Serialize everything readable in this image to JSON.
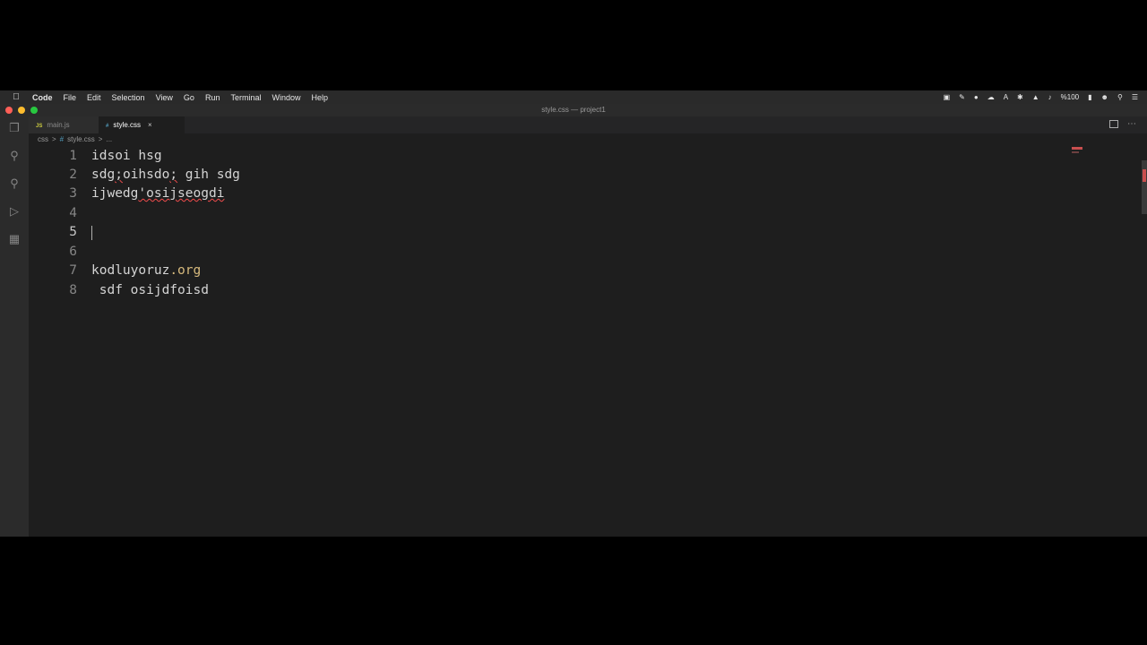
{
  "menubar": {
    "apple_icon": "apple-icon",
    "items": [
      "Code",
      "File",
      "Edit",
      "Selection",
      "View",
      "Go",
      "Run",
      "Terminal",
      "Window",
      "Help"
    ],
    "status": {
      "battery_text": "%100"
    }
  },
  "window": {
    "title": "style.css — project1"
  },
  "tabs": [
    {
      "label": "main.js",
      "type_badge": "JS",
      "active": false
    },
    {
      "label": "style.css",
      "type_badge": "#",
      "active": true,
      "close": "×"
    }
  ],
  "breadcrumb": [
    "css",
    ">",
    "#",
    "style.css",
    ">",
    "..."
  ],
  "editor": {
    "current_line": 5,
    "lines": [
      {
        "number": "1",
        "text": "idsoi hsg"
      },
      {
        "number": "2",
        "text_a": "sdg",
        "text_err": ";",
        "text_b": "oihsdo",
        "text_err2": ";",
        "text_c": " gih sdg"
      },
      {
        "number": "3",
        "text_a": "ijwedg",
        "text_err": "'osijseogdi"
      },
      {
        "number": "4",
        "text": ""
      },
      {
        "number": "5",
        "text": ""
      },
      {
        "number": "6",
        "text": ""
      },
      {
        "number": "7",
        "text_a": "kodluyoruz",
        "text_b": ".org"
      },
      {
        "number": "8",
        "text": " sdf osijdfoisd"
      }
    ]
  },
  "colors": {
    "editor_bg": "#1e1e1e",
    "error": "#f14c4c",
    "tld": "#d7ba7d"
  }
}
